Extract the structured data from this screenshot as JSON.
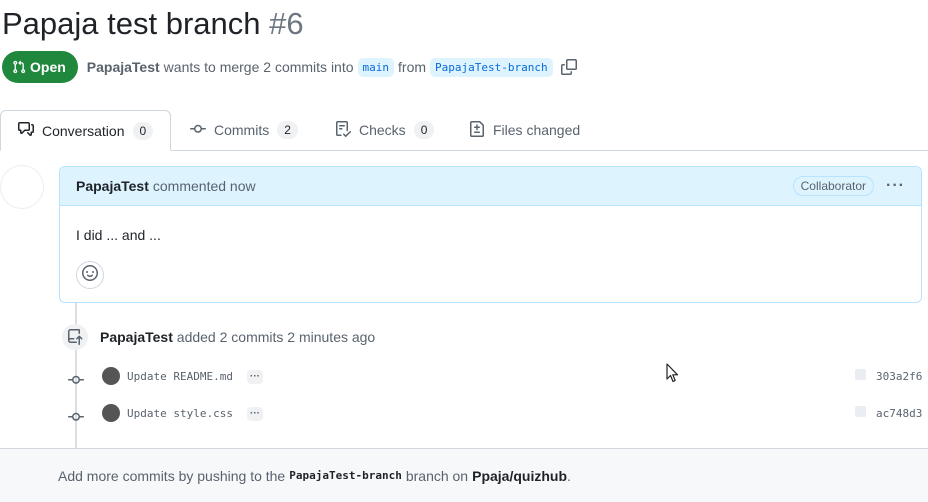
{
  "pr": {
    "title": "Papaja test branch",
    "number": "#6",
    "status": "Open",
    "author": "PapajaTest",
    "merge_text": "wants to merge 2 commits into",
    "base_branch": "main",
    "from_text": "from",
    "head_branch": "PapajaTest-branch"
  },
  "tabs": [
    {
      "label": "Conversation",
      "count": "0",
      "icon": "comment-discussion-icon"
    },
    {
      "label": "Commits",
      "count": "2",
      "icon": "git-commit-icon"
    },
    {
      "label": "Checks",
      "count": "0",
      "icon": "checklist-icon"
    },
    {
      "label": "Files changed",
      "icon": "file-diff-icon"
    }
  ],
  "comment": {
    "author": "PapajaTest",
    "action": "commented now",
    "role_badge": "Collaborator",
    "menu": "···",
    "body": "I did ... and ..."
  },
  "event": {
    "author": "PapajaTest",
    "text": "added 2 commits 2 minutes ago"
  },
  "commits": [
    {
      "message": "Update README.md",
      "more": "···",
      "sha": "303a2f6"
    },
    {
      "message": "Update style.css",
      "more": "···",
      "sha": "ac748d3"
    }
  ],
  "footer": {
    "prefix": "Add more commits by pushing to the",
    "branch": "PapajaTest-branch",
    "middle": "branch on",
    "repo": "Ppaja/quizhub",
    "suffix": "."
  },
  "colors": {
    "open_green": "#1f883d",
    "link_blue": "#0969da",
    "header_blue": "#ddf4ff"
  }
}
